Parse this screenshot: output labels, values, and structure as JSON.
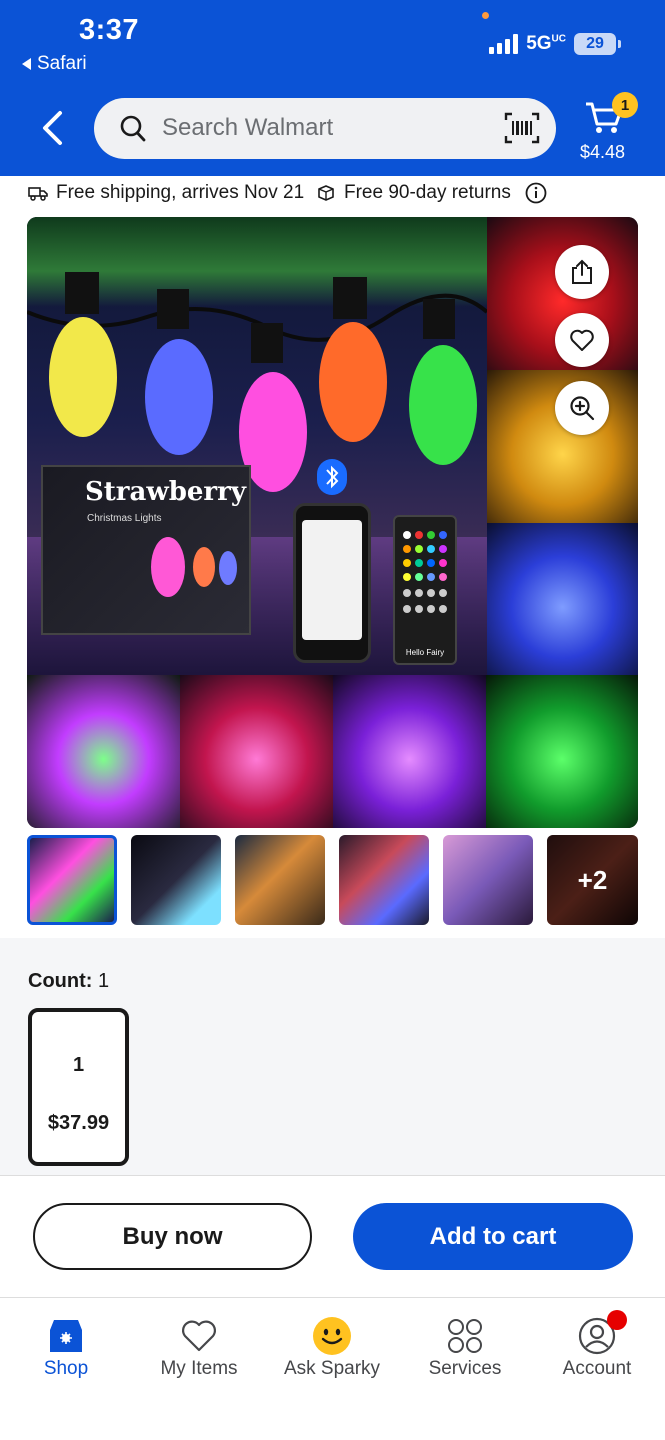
{
  "status": {
    "time": "3:37",
    "back_app": "Safari",
    "network": "5G",
    "battery": "29"
  },
  "header": {
    "search_placeholder": "Search Walmart",
    "cart_count": "1",
    "cart_total": "$4.48"
  },
  "shipping": {
    "free_shipping": "Free shipping, arrives Nov 21",
    "returns": "Free 90-day returns"
  },
  "gallery": {
    "box_brand": "Strawberry",
    "box_sub": "Christmas Lights",
    "remote_label": "Hello Fairy",
    "more_count": "+2"
  },
  "options": {
    "label": "Count:",
    "selected": "1",
    "items": [
      {
        "qty": "1",
        "price": "$37.99"
      }
    ]
  },
  "actions": {
    "buy_now": "Buy now",
    "add_to_cart": "Add to cart"
  },
  "tabs": [
    {
      "label": "Shop",
      "icon": "store-icon",
      "active": true
    },
    {
      "label": "My Items",
      "icon": "heart-icon"
    },
    {
      "label": "Ask Sparky",
      "icon": "sparky-icon"
    },
    {
      "label": "Services",
      "icon": "services-grid-icon"
    },
    {
      "label": "Account",
      "icon": "account-icon"
    }
  ],
  "colors": {
    "brand_blue": "#0b53d6",
    "accent_yellow": "#ffc220",
    "notification_red": "#e60000"
  }
}
